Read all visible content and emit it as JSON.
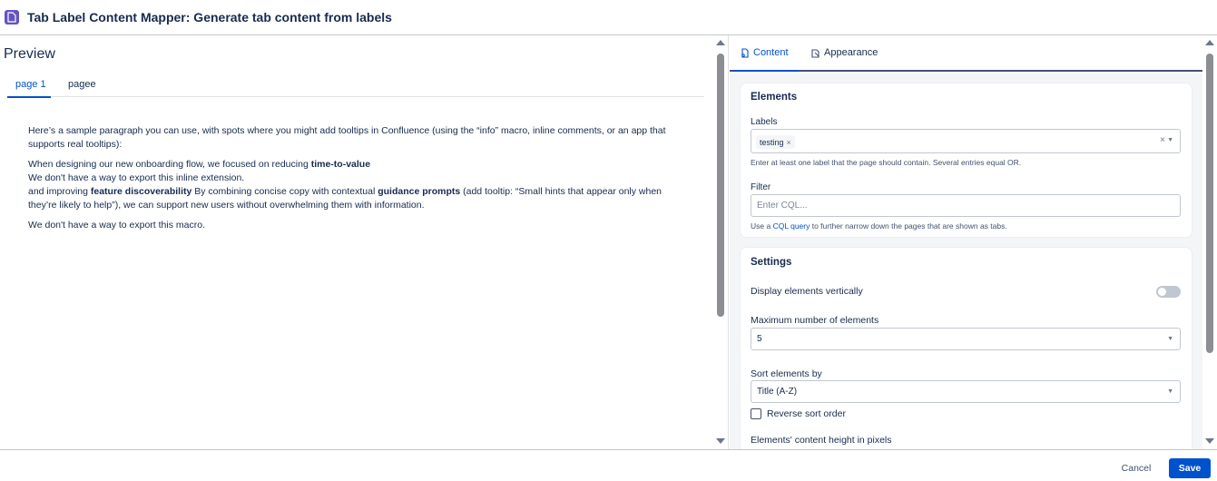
{
  "header": {
    "title": "Tab Label Content Mapper: Generate tab content from labels"
  },
  "preview": {
    "title": "Preview",
    "tabs": [
      {
        "label": "page 1"
      },
      {
        "label": "pagee"
      }
    ],
    "paragraphs": {
      "intro": "Here’s a sample paragraph you can use, with spots where you might add tooltips in Confluence (using the “info” macro, inline comments, or an app that supports real tooltips):",
      "p2_a": "When designing our new onboarding flow, we focused on reducing ",
      "p2_b": "time-to-value",
      "p2_c": "We don't have a way to export this inline extension.",
      "p2_d": "and improving ",
      "p2_e": "feature discoverability",
      "p2_f": " By combining concise copy with contextual ",
      "p2_g": "guidance prompts",
      "p2_h": " (add tooltip: “Small hints that appear only when they’re likely to help”), we can support new users without overwhelming them with information.",
      "p3": "We don't have a way to export this macro."
    }
  },
  "config": {
    "tabs": [
      {
        "label": "Content",
        "icon": "content-icon"
      },
      {
        "label": "Appearance",
        "icon": "appearance-icon"
      }
    ],
    "elements": {
      "title": "Elements",
      "labels_label": "Labels",
      "labels_chip": "testing",
      "labels_help": "Enter at least one label that the page should contain. Several entries equal OR.",
      "filter_label": "Filter",
      "filter_placeholder": "Enter CQL...",
      "filter_help_pre": "Use a ",
      "filter_help_link": "CQL query",
      "filter_help_post": " to further narrow down the pages that are shown as tabs."
    },
    "settings": {
      "title": "Settings",
      "vertical_label": "Display elements vertically",
      "max_label": "Maximum number of elements",
      "max_value": "5",
      "sort_label": "Sort elements by",
      "sort_value": "Title (A-Z)",
      "reverse_label": "Reverse sort order",
      "height_label": "Elements' content height in pixels"
    }
  },
  "footer": {
    "cancel": "Cancel",
    "save": "Save"
  },
  "colors": {
    "accent": "#0052cc",
    "app_icon": "#6554c0"
  }
}
